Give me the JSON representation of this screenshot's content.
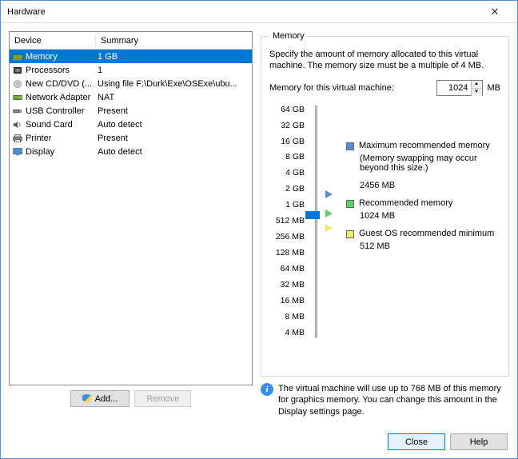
{
  "window": {
    "title": "Hardware"
  },
  "deviceHeader": {
    "device": "Device",
    "summary": "Summary"
  },
  "devices": [
    {
      "name": "Memory",
      "summary": "1 GB",
      "icon": "memory-icon",
      "selected": true
    },
    {
      "name": "Processors",
      "summary": "1",
      "icon": "cpu-icon"
    },
    {
      "name": "New CD/DVD (...",
      "summary": "Using file F:\\Durk\\Exe\\OSExe\\ubu...",
      "icon": "cd-icon"
    },
    {
      "name": "Network Adapter",
      "summary": "NAT",
      "icon": "nic-icon"
    },
    {
      "name": "USB Controller",
      "summary": "Present",
      "icon": "usb-icon"
    },
    {
      "name": "Sound Card",
      "summary": "Auto detect",
      "icon": "sound-icon"
    },
    {
      "name": "Printer",
      "summary": "Present",
      "icon": "printer-icon"
    },
    {
      "name": "Display",
      "summary": "Auto detect",
      "icon": "display-icon"
    }
  ],
  "buttons": {
    "add": "Add...",
    "remove": "Remove",
    "close": "Close",
    "help": "Help"
  },
  "memory": {
    "legend": "Memory",
    "desc": "Specify the amount of memory allocated to this virtual machine. The memory size must be a multiple of 4 MB.",
    "inputLabel": "Memory for this virtual machine:",
    "value": "1024",
    "unit": "MB",
    "ticks": [
      "64 GB",
      "32 GB",
      "16 GB",
      "8 GB",
      "4 GB",
      "2 GB",
      "1 GB",
      "512 MB",
      "256 MB",
      "128 MB",
      "64 MB",
      "32 MB",
      "16 MB",
      "8 MB",
      "4 MB"
    ],
    "markers": {
      "max": {
        "color": "#5b8bd4",
        "label": "Maximum recommended memory",
        "sub": "(Memory swapping may occur beyond this size.)",
        "value": "2456 MB"
      },
      "rec": {
        "color": "#5fcf5f",
        "label": "Recommended memory",
        "value": "1024 MB"
      },
      "guest": {
        "color": "#f5e96b",
        "label": "Guest OS recommended minimum",
        "value": "512 MB"
      }
    },
    "info": "The virtual machine will use up to 768 MB of this memory for graphics memory. You can change this amount in the Display settings page."
  }
}
